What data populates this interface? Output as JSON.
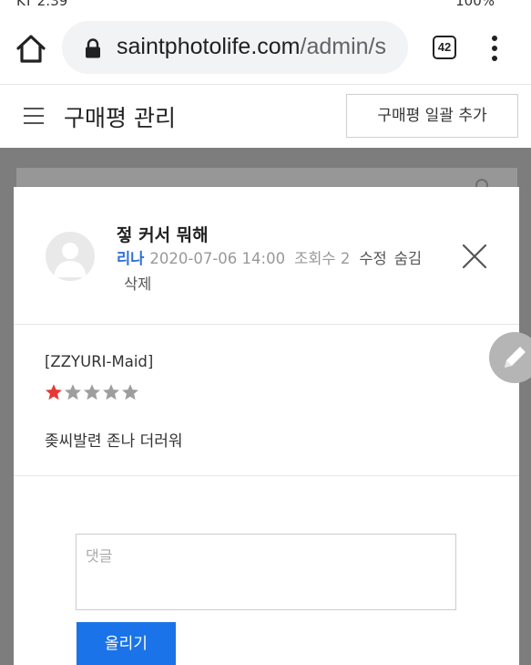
{
  "status_bar": {
    "time": "KT 2:39",
    "battery": "100%"
  },
  "browser": {
    "url_host": "saintphotolife.com",
    "url_path": "/admin/s",
    "tab_count": "42"
  },
  "header": {
    "title": "구매평 관리",
    "add_bulk_label": "구매평 일괄 추가"
  },
  "review": {
    "title": "젛 커서 뭐해",
    "author": "리나",
    "date": "2020-07-06 14:00",
    "views": "조회수 2",
    "edit_label": "수정",
    "hide_label": "숨김",
    "delete_label": "삭제",
    "product": "[ZZYURI-Maid]",
    "rating": 1,
    "rating_max": 5,
    "body": "좆씨발련 존나 더러워"
  },
  "comment": {
    "placeholder": "댓글",
    "submit_label": "올리기"
  },
  "colors": {
    "accent_blue": "#1a73e8",
    "author_blue": "#2e6fd8",
    "star_active": "#e53935",
    "star_inactive": "#9e9e9e",
    "overlay": "#7d7d7d"
  }
}
